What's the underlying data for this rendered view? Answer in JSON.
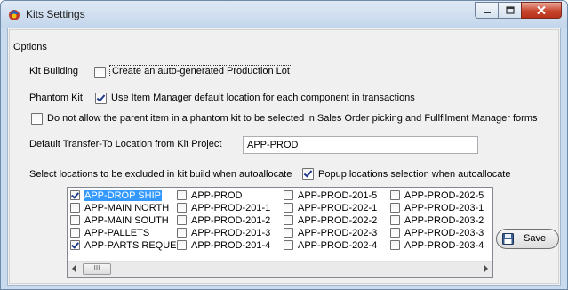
{
  "window": {
    "title": "Kits Settings",
    "controls": {
      "minimize": "minimize-icon",
      "maximize": "maximize-icon",
      "close": "close-icon"
    }
  },
  "options": {
    "group_title": "Options",
    "kit_building_label": "Kit Building",
    "auto_lot_label": "Create an auto-generated Production Lot",
    "auto_lot_checked": false,
    "phantom_kit_label": "Phantom Kit",
    "use_default_location_label": "Use Item Manager default location for each component in transactions",
    "use_default_location_checked": true,
    "disallow_parent_label": "Do not allow the parent item in a phantom kit to be selected in Sales Order picking and Fullfilment Manager forms",
    "disallow_parent_checked": false,
    "transfer_to_label": "Default Transfer-To Location from Kit Project",
    "transfer_to_value": "APP-PROD",
    "exclude_locations_label": "Select locations to be excluded in kit build when autoallocate",
    "popup_selection_label": "Popup locations selection when autoallocate",
    "popup_selection_checked": true
  },
  "locations": {
    "columns": [
      [
        {
          "label": "APP-DROP SHIP",
          "checked": true,
          "selected": true
        },
        {
          "label": "APP-MAIN NORTH",
          "checked": false
        },
        {
          "label": "APP-MAIN SOUTH",
          "checked": false
        },
        {
          "label": "APP-PALLETS",
          "checked": false
        },
        {
          "label": "APP-PARTS REQUE",
          "checked": true
        }
      ],
      [
        {
          "label": "APP-PROD",
          "checked": false
        },
        {
          "label": "APP-PROD-201-1",
          "checked": false
        },
        {
          "label": "APP-PROD-201-2",
          "checked": false
        },
        {
          "label": "APP-PROD-201-3",
          "checked": false
        },
        {
          "label": "APP-PROD-201-4",
          "checked": false
        }
      ],
      [
        {
          "label": "APP-PROD-201-5",
          "checked": false
        },
        {
          "label": "APP-PROD-202-1",
          "checked": false
        },
        {
          "label": "APP-PROD-202-2",
          "checked": false
        },
        {
          "label": "APP-PROD-202-3",
          "checked": false
        },
        {
          "label": "APP-PROD-202-4",
          "checked": false
        }
      ],
      [
        {
          "label": "APP-PROD-202-5",
          "checked": false
        },
        {
          "label": "APP-PROD-203-1",
          "checked": false
        },
        {
          "label": "APP-PROD-203-2",
          "checked": false
        },
        {
          "label": "APP-PROD-203-3",
          "checked": false
        },
        {
          "label": "APP-PROD-203-4",
          "checked": false
        }
      ]
    ],
    "scroll_thumb": "III"
  },
  "save_button": {
    "label": "Save",
    "icon": "save-icon"
  }
}
